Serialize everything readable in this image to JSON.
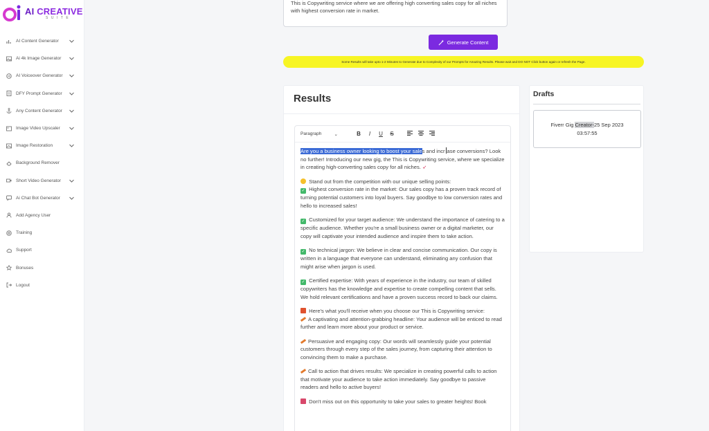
{
  "brand": {
    "title_prefix": "AI",
    "title_main": "CREATIVE",
    "subtitle": "SUITE"
  },
  "sidebar": {
    "items": [
      {
        "label": "AI Content Generator",
        "icon": "bar-chart-icon",
        "has_chevron": true
      },
      {
        "label": "Ai 4k Image Generator",
        "icon": "image-icon",
        "has_chevron": true
      },
      {
        "label": "AI Voiceover Generator",
        "icon": "voice-icon",
        "has_chevron": true
      },
      {
        "label": "DFY Prompt Generator",
        "icon": "document-icon",
        "has_chevron": true
      },
      {
        "label": "Any Content Generator",
        "icon": "anchor-icon",
        "has_chevron": true
      },
      {
        "label": "Image Video Upscaler",
        "icon": "picture-icon",
        "has_chevron": true
      },
      {
        "label": "Image Restoration",
        "icon": "photo-icon",
        "has_chevron": true
      },
      {
        "label": "Background Remover",
        "icon": "eraser-icon",
        "has_chevron": false
      },
      {
        "label": "Short Video Generator",
        "icon": "video-icon",
        "has_chevron": true
      },
      {
        "label": "Ai Chat Bot Generator",
        "icon": "chat-icon",
        "has_chevron": true
      },
      {
        "label": "Add Agency User",
        "icon": "user-icon",
        "has_chevron": false
      },
      {
        "label": "Training",
        "icon": "help-icon",
        "has_chevron": false
      },
      {
        "label": "Support",
        "icon": "cloud-icon",
        "has_chevron": false
      },
      {
        "label": "Bonuses",
        "icon": "star-icon",
        "has_chevron": false
      },
      {
        "label": "Logout",
        "icon": "logout-icon",
        "has_chevron": false
      }
    ]
  },
  "prompt": {
    "value": "This is Copywriting service where we are offering high converting sales copy for all niches with highest conversion rate in market."
  },
  "generate_button": {
    "label": "Generate Content"
  },
  "notice": {
    "text": "Some Results will take upto 1-2 Minutes to Generate due to Complexity of our Prompts for Amazing Results. Please wait and DO NOT Click button again or refresh the Page."
  },
  "results": {
    "title": "Results",
    "toolbar": {
      "format": "Paragraph",
      "bold": "B",
      "italic": "I",
      "underline": "U",
      "strike": "S"
    },
    "content": {
      "p1_highlight": "Are you a business owner looking to boost your sale",
      "p1_rest_a": "s and incr",
      "p1_rest_b": "ase conversions? Look no further! Introducing our new gig, the This is Copywriting service, where we specialize in creating high-converting sales copy for all niches.",
      "p2a": "Stand out from the competition with our unique selling points:",
      "p2b": "Highest conversion rate in the market: Our sales copy has a proven track record of turning potential customers into loyal buyers. Say goodbye to low conversion rates and hello to increased sales!",
      "p3": "Customized for your target audience: We understand the importance of catering to a specific audience. Whether you're a small business owner or a digital marketer, our copy will captivate your intended audience and inspire them to take action.",
      "p4": "No technical jargon: We believe in clear and concise communication. Our copy is written in a language that everyone can understand, eliminating any confusion that might arise when jargon is used.",
      "p5": "Certified expertise: With years of experience in the industry, our team of skilled copywriters has the knowledge and expertise to create compelling content that sells. We hold relevant certifications and have a proven success record to back our claims.",
      "p6a": "Here's what you'll receive when you choose our This is Copywriting service:",
      "p6b": "A captivating and attention-grabbing headline: Your audience will be enticed to read further and learn more about your product or service.",
      "p7": "Persuasive and engaging copy: Our words will seamlessly guide your potential customers through every step of the sales journey, from capturing their attention to convincing them to make a purchase.",
      "p8": "Call to action that drives results: We specialize in creating powerful calls to action that motivate your audience to take action immediately. Say goodbye to passive readers and hello to active buyers!",
      "p9": "Don't miss out on this opportunity to take your sales to greater heights! Book"
    }
  },
  "drafts": {
    "title": "Drafts",
    "item": {
      "name_a": "Fiverr Gig ",
      "name_hl": "Creator-",
      "date": "25 Sep 2023",
      "time": "03:57:55"
    }
  },
  "colors": {
    "accent": "#7b2ae0",
    "notice": "#f7f524",
    "highlight": "#3c6bd6"
  }
}
